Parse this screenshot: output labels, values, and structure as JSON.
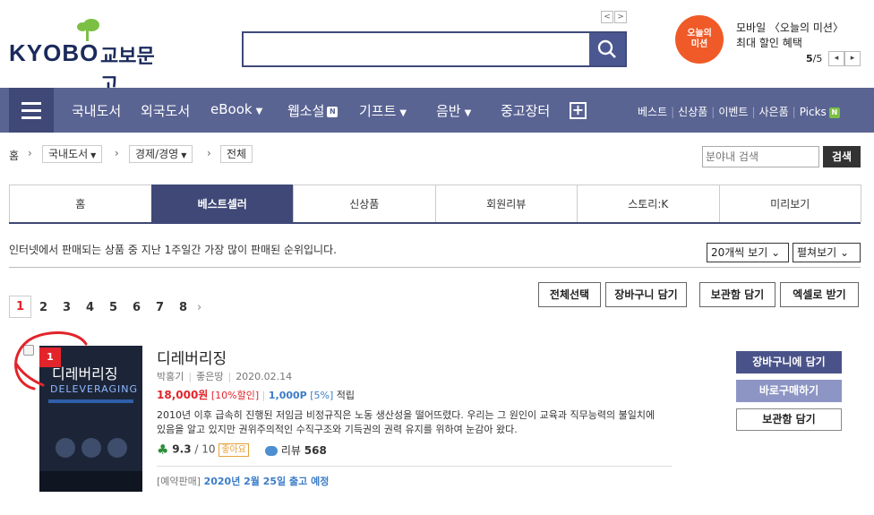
{
  "header": {
    "logo_text": "KYOBO",
    "logo_kr": "교보문고",
    "search_placeholder": "",
    "ad": {
      "badge_line1": "오늘의",
      "badge_line2": "미션",
      "line1": "모바일 〈오늘의 미션〉",
      "line2": "최대 할인 혜택",
      "page_current": "5",
      "page_total": "/5"
    }
  },
  "nav": {
    "items": [
      "국내도서",
      "외국도서",
      "eBook",
      "웹소설",
      "기프트",
      "음반",
      "중고장터"
    ],
    "new_badge": "N",
    "sub_items": [
      "베스트",
      "신상품",
      "이벤트",
      "사은품",
      "Picks"
    ]
  },
  "breadcrumb": {
    "home": "홈",
    "level1": "국내도서",
    "level2": "경제/경영",
    "level3": "전체",
    "search_placeholder": "분야내 검색",
    "search_button": "검색"
  },
  "tabs": [
    "홈",
    "베스트셀러",
    "신상품",
    "회원리뷰",
    "스토리:K",
    "미리보기"
  ],
  "list": {
    "description": "인터넷에서 판매되는 상품 중 지난 1주일간 가장 많이 판매된 순위입니다.",
    "per_page": "20개씩 보기",
    "view_mode": "펼쳐보기",
    "pages": [
      "1",
      "2",
      "3",
      "4",
      "5",
      "6",
      "7",
      "8"
    ],
    "actions": [
      "전체선택",
      "장바구니 담기",
      "보관함 담기",
      "엑셀로 받기"
    ]
  },
  "product": {
    "rank": "1",
    "title": "디레버리징",
    "cover_title": "디레버리징",
    "cover_sub": "DELEVERAGING",
    "author": "박홍기",
    "publisher": "좋은땅",
    "date": "2020.02.14",
    "price": "18,000원",
    "discount": "[10%할인]",
    "point": "1,000P",
    "point_pct": "[5%]",
    "point_label": "적립",
    "summary": "2010년 이후 급속히 진행된 저임금 비정규직은 노동 생산성을 떨어뜨렸다. 우리는 그 원인이 교육과 직무능력의 불일치에 있음을 알고 있지만 권위주의적인 수직구조와 기득권의 권력 유지를 위하여 눈감아 왔다.",
    "rating": "9.3",
    "rating_max": "/ 10",
    "rating_badge": "좋아요",
    "review_label": "리뷰",
    "review_count": "568",
    "preorder_label": "[예약판매]",
    "preorder_date": "2020년 2월 25일 출고 예정",
    "buttons": {
      "cart": "장바구니에 담기",
      "buy": "바로구매하기",
      "keep": "보관함 담기"
    }
  },
  "colors": {
    "nav": "#5a6493",
    "nav_dark": "#3f4876",
    "accent_red": "#e3242b",
    "point_blue": "#3c7cc7"
  }
}
